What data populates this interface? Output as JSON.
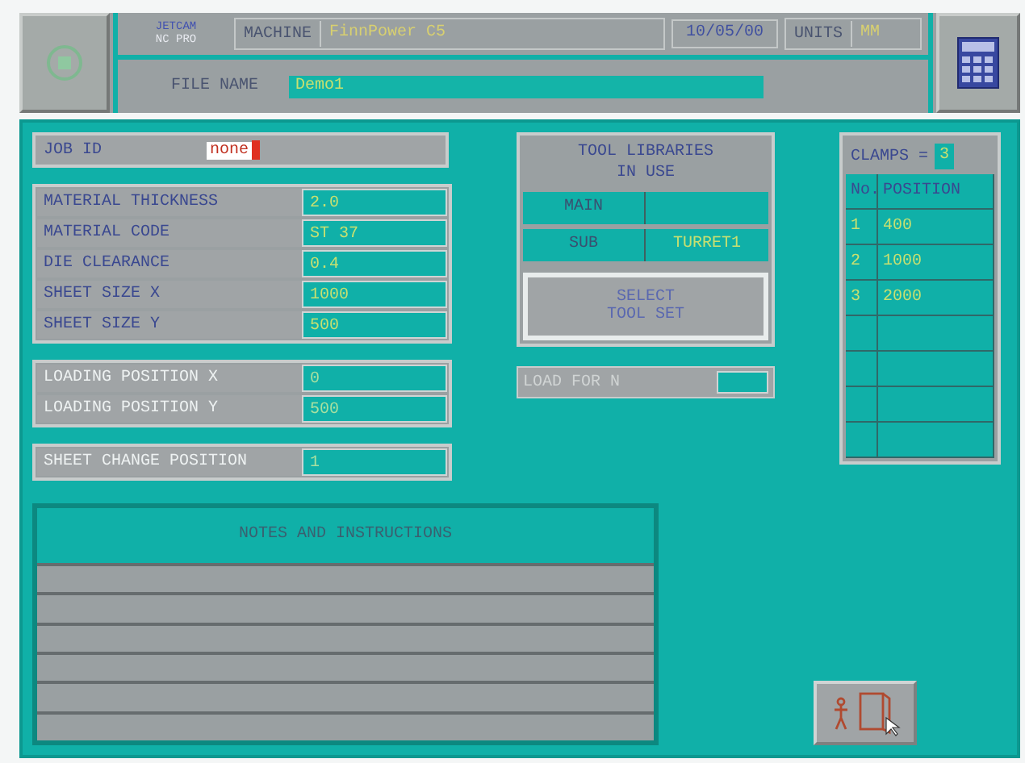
{
  "header": {
    "logo_top": "JETCAM",
    "logo_bottom": "NC PRO",
    "machine_label": "MACHINE",
    "machine_value": "FinnPower C5",
    "date": "10/05/00",
    "units_label": "UNITS",
    "units_value": "MM",
    "file_name_label": "FILE NAME",
    "file_name_value": "Demo1"
  },
  "job_id": {
    "label": "JOB ID",
    "value": "none"
  },
  "material_fields": [
    {
      "label": "MATERIAL THICKNESS",
      "value": "2.0",
      "disabled": false
    },
    {
      "label": "MATERIAL CODE",
      "value": "ST 37",
      "disabled": false
    },
    {
      "label": "DIE CLEARANCE",
      "value": "0.4",
      "disabled": false
    },
    {
      "label": "SHEET SIZE X",
      "value": "1000",
      "disabled": false
    },
    {
      "label": "SHEET SIZE Y",
      "value": "500",
      "disabled": false
    }
  ],
  "loading_fields": [
    {
      "label": "LOADING POSITION X",
      "value": "0",
      "disabled": true
    },
    {
      "label": "LOADING POSITION Y",
      "value": "500",
      "disabled": true
    }
  ],
  "extra_field": {
    "label": "SHEET CHANGE POSITION",
    "value": "1",
    "disabled": true
  },
  "tool_libraries": {
    "title": "TOOL LIBRARIES\nIN USE",
    "rows": [
      {
        "label": "MAIN"
      },
      {
        "label": "SUB",
        "value": "TURRET1"
      }
    ],
    "button": "SELECT\nTOOL SET"
  },
  "load_for": {
    "label": "LOAD FOR N",
    "disabled": true
  },
  "clamps": {
    "label": "CLAMPS =",
    "count": "3",
    "columns": [
      "No.",
      "POSITION"
    ],
    "rows": [
      [
        "1",
        "400"
      ],
      [
        "2",
        "1000"
      ],
      [
        "3",
        "2000"
      ]
    ]
  },
  "notes": {
    "title": "NOTES AND INSTRUCTIONS"
  }
}
